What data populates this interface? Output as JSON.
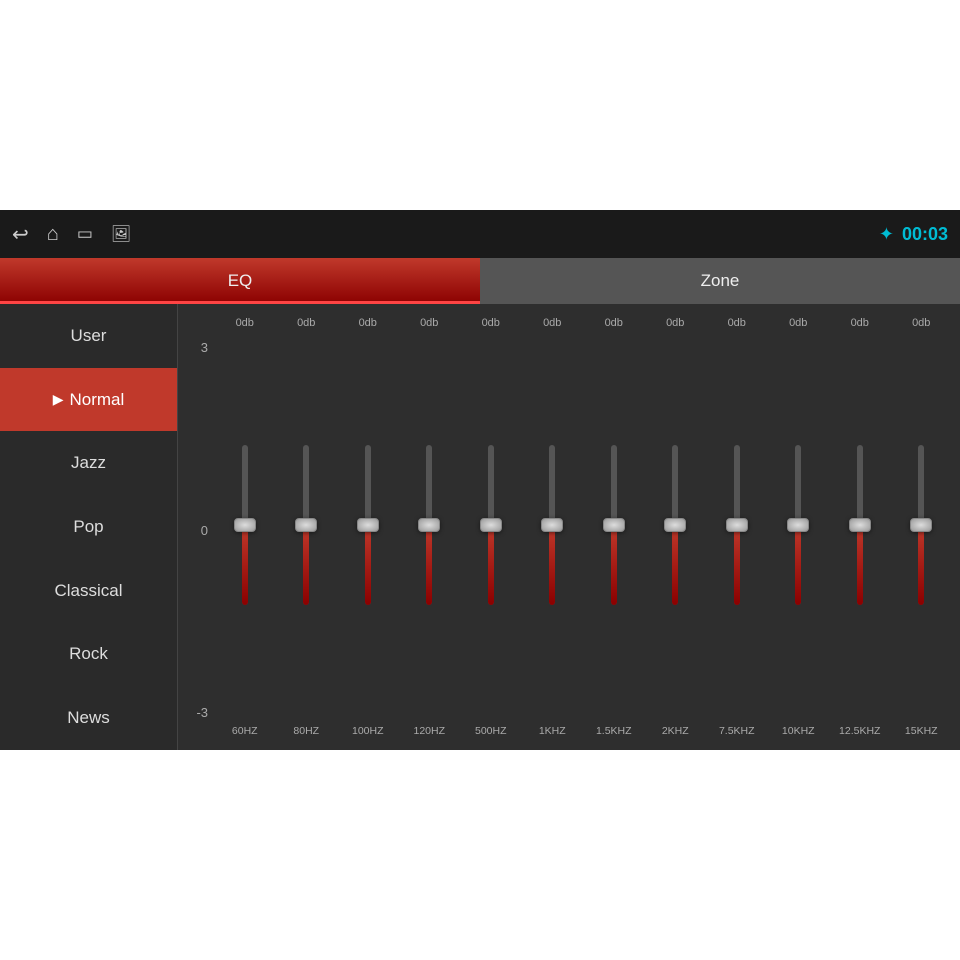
{
  "topBar": {
    "timer": "00:03",
    "btLabel": "BT"
  },
  "tabs": [
    {
      "label": "EQ",
      "active": true
    },
    {
      "label": "Zone",
      "active": false
    }
  ],
  "sidebar": {
    "items": [
      {
        "label": "User",
        "active": false,
        "showPlay": false
      },
      {
        "label": "Normal",
        "active": true,
        "showPlay": true
      },
      {
        "label": "Jazz",
        "active": false,
        "showPlay": false
      },
      {
        "label": "Pop",
        "active": false,
        "showPlay": false
      },
      {
        "label": "Classical",
        "active": false,
        "showPlay": false
      },
      {
        "label": "Rock",
        "active": false,
        "showPlay": false
      },
      {
        "label": "News",
        "active": false,
        "showPlay": false
      }
    ]
  },
  "eq": {
    "yAxis": [
      "3",
      "0",
      "-3"
    ],
    "dbLabels": [
      "0db",
      "0db",
      "0db",
      "0db",
      "0db",
      "0db",
      "0db",
      "0db",
      "0db",
      "0db",
      "0db",
      "0db"
    ],
    "freqLabels": [
      "60HZ",
      "80HZ",
      "100HZ",
      "120HZ",
      "500HZ",
      "1KHZ",
      "1.5KHZ",
      "2KHZ",
      "7.5KHZ",
      "10KHZ",
      "12.5KHZ",
      "15KHZ"
    ],
    "sliderPositions": [
      50,
      50,
      50,
      50,
      50,
      50,
      50,
      50,
      50,
      50,
      50,
      50
    ]
  },
  "icons": {
    "back": "↩",
    "home": "⌂",
    "window": "▭",
    "image": "🖼",
    "bt": "✦"
  }
}
